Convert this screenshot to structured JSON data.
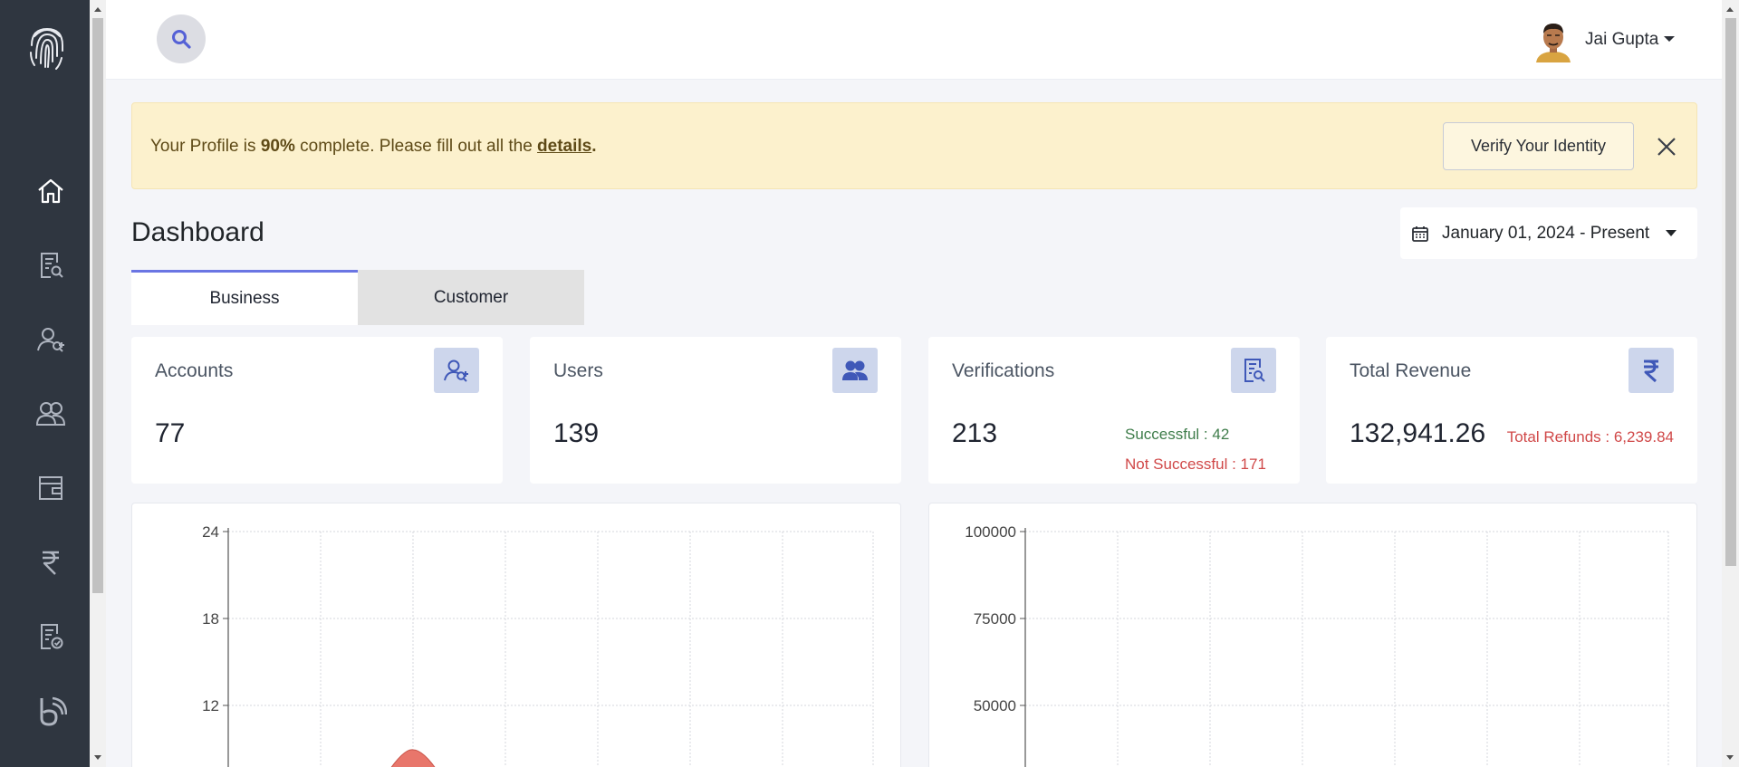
{
  "sidebar": {
    "items": [
      {
        "name": "home-icon",
        "label": "Home"
      },
      {
        "name": "document-search-icon",
        "label": "Verifications"
      },
      {
        "name": "user-add-icon",
        "label": "Accounts"
      },
      {
        "name": "users-icon",
        "label": "Users"
      },
      {
        "name": "wallet-icon",
        "label": "Wallet"
      },
      {
        "name": "rupee-icon",
        "label": "Revenue"
      },
      {
        "name": "document-check-icon",
        "label": "Reports"
      },
      {
        "name": "brand-b-icon",
        "label": "Brand"
      }
    ],
    "background": "#2f3640"
  },
  "topbar": {
    "user_name": "Jai Gupta"
  },
  "alert": {
    "prefix": "Your Profile is ",
    "percent": "90%",
    "middle": " complete. Please fill out all the ",
    "link": "details",
    "suffix": ".",
    "verify_label": "Verify Your Identity"
  },
  "page": {
    "title": "Dashboard",
    "date_range": "January 01, 2024 - Present"
  },
  "tabs": [
    {
      "label": "Business",
      "active": true
    },
    {
      "label": "Customer",
      "active": false
    }
  ],
  "cards": {
    "accounts": {
      "title": "Accounts",
      "value": "77"
    },
    "users": {
      "title": "Users",
      "value": "139"
    },
    "verifications": {
      "title": "Verifications",
      "value": "213",
      "successful": "Successful : 42",
      "not_successful": "Not Successful : 171"
    },
    "revenue": {
      "title": "Total Revenue",
      "value": "132,941.26",
      "refunds": "Total Refunds : 6,239.84"
    }
  },
  "chart_data": [
    {
      "type": "area",
      "yticks": [
        "24",
        "18",
        "12"
      ],
      "ylim": [
        0,
        24
      ],
      "grid": true,
      "series_color": "#e8766b"
    },
    {
      "type": "line",
      "yticks": [
        "100000",
        "75000",
        "50000"
      ],
      "ylim": [
        0,
        100000
      ],
      "grid": true
    }
  ],
  "colors": {
    "accent": "#6a75e3",
    "alert_bg": "#fcf1cd",
    "success": "#3f7d4b",
    "danger": "#d04848"
  }
}
